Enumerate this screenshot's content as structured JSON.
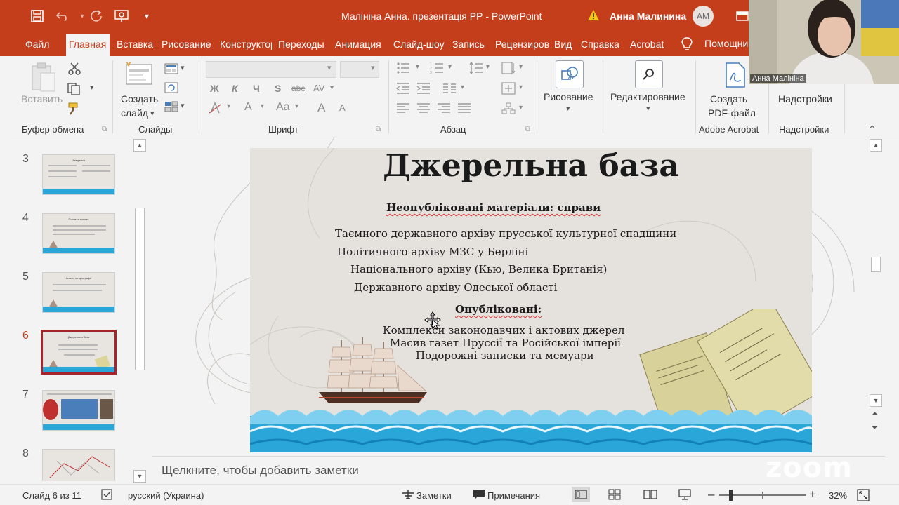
{
  "window": {
    "title": "Малініна Анна. презентація РР  -  PowerPoint",
    "user_name": "Анна Малинина",
    "user_initials": "АМ"
  },
  "tabs": [
    {
      "label": "Файл"
    },
    {
      "label": "Главная"
    },
    {
      "label": "Вставка"
    },
    {
      "label": "Рисование"
    },
    {
      "label": "Конструктор"
    },
    {
      "label": "Переходы"
    },
    {
      "label": "Анимация"
    },
    {
      "label": "Слайд-шоу"
    },
    {
      "label": "Запись"
    },
    {
      "label": "Рецензирование"
    },
    {
      "label": "Вид"
    },
    {
      "label": "Справка"
    },
    {
      "label": "Acrobat"
    }
  ],
  "tell_me": "Помощник",
  "ribbon": {
    "paste_label": "Вставить",
    "create_slide_label_1": "Создать",
    "create_slide_label_2": "слайд",
    "font_buttons": [
      "Ж",
      "К",
      "Ч",
      "S",
      "abc",
      "AV"
    ],
    "font_row3": [
      "A",
      "Aa",
      "A",
      "A"
    ],
    "drawing_label": "Рисование",
    "editing_label": "Редактирование",
    "create_pdf_label_1": "Создать",
    "create_pdf_label_2": "PDF-файл",
    "addins_label": "Надстройки",
    "groups": {
      "clipboard": "Буфер обмена",
      "slides": "Слайды",
      "font": "Шрифт",
      "paragraph": "Абзац",
      "acrobat": "Adobe Acrobat",
      "addins": "Надстройки"
    }
  },
  "thumbnails": [
    {
      "number": "3",
      "title": "Завдання"
    },
    {
      "number": "4",
      "title": "Поняття понять"
    },
    {
      "number": "5",
      "title": "Аналіз історіографії"
    },
    {
      "number": "6",
      "title": "Джерельна база"
    },
    {
      "number": "7",
      "title": ""
    },
    {
      "number": "8",
      "title": ""
    }
  ],
  "slide": {
    "title": "Джерельна база",
    "heading_unpublished": "Неопубліковані матеріали: справи",
    "unpublished_items": [
      "Таємного державного архіву прусської культурної спадщини",
      "Політичного архіву МЗС у Берліні",
      "Національного архіву (Кью, Велика Британія)",
      "Державного архіву Одеської області"
    ],
    "heading_published": "Опубліковані:",
    "published_items": [
      "Комплекси законодавчих і актових джерел",
      "Масив газет Пруссії та Російської імперії",
      "Подорожні записки та мемуари"
    ]
  },
  "notes_placeholder": "Щелкните, чтобы добавить заметки",
  "status": {
    "slide_indicator": "Слайд 6 из 11",
    "language": "русский (Украина)",
    "notes_label": "Заметки",
    "comments_label": "Примечания",
    "zoom": "32%"
  },
  "video": {
    "participant": "Анна Малініна",
    "watermark": "zoom"
  },
  "colors": {
    "accent": "#c43e1c",
    "ribbon_bg": "#f3f3f3",
    "slide_bg": "#e5e1dc",
    "sea": "#2aa7d8",
    "selected_thumb": "#a4262c"
  }
}
